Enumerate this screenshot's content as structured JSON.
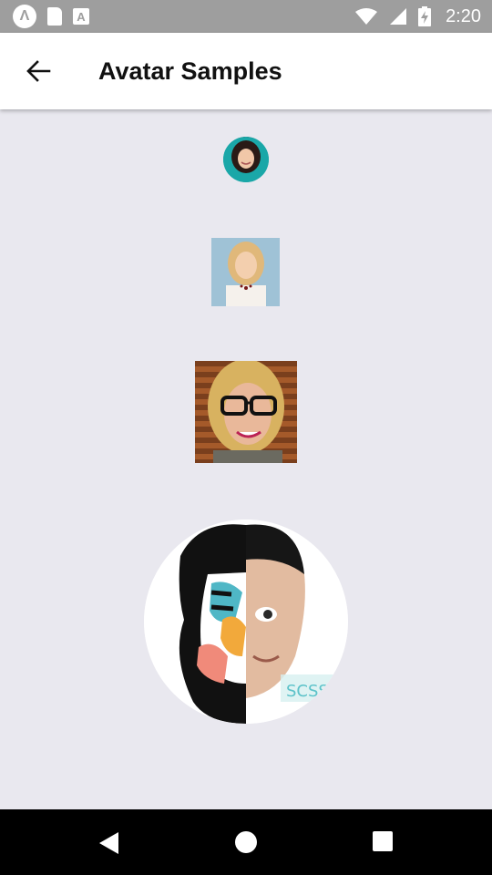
{
  "status_bar": {
    "time": "2:20",
    "icons": [
      "app-a-icon",
      "sd-card-icon",
      "text-a-icon",
      "wifi-icon",
      "signal-icon",
      "battery-charging-icon"
    ]
  },
  "app_bar": {
    "title": "Avatar Samples",
    "back_icon": "arrow-back-icon"
  },
  "avatars": [
    {
      "shape": "circle",
      "size": "small"
    },
    {
      "shape": "square",
      "size": "medium"
    },
    {
      "shape": "square",
      "size": "large"
    },
    {
      "shape": "circle",
      "size": "xlarge"
    }
  ],
  "nav_bar": {
    "icons": [
      "nav-back-icon",
      "nav-home-icon",
      "nav-recents-icon"
    ]
  },
  "colors": {
    "background": "#e9e8ef",
    "status_bar": "#9e9e9e",
    "app_bar": "#ffffff",
    "nav_bar": "#000000"
  }
}
